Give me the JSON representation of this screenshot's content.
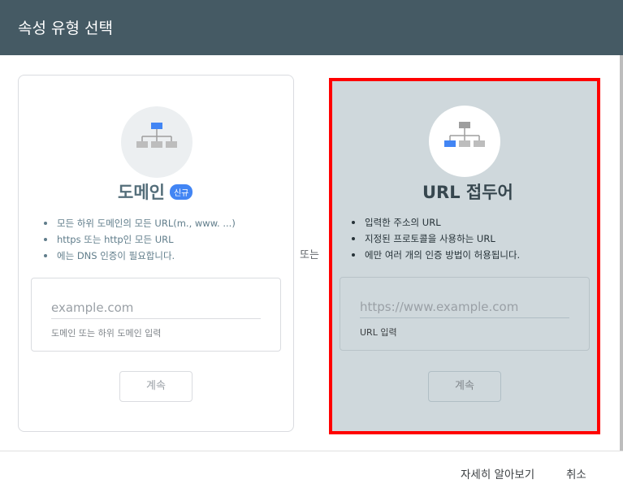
{
  "header": {
    "title": "속성 유형 선택"
  },
  "domain_card": {
    "title": "도메인",
    "badge": "신규",
    "features": [
      "모든 하위 도메인의 모든 URL(m., www. ...)",
      "https 또는 http인 모든 URL",
      "에는 DNS 인증이 필요합니다."
    ],
    "input": {
      "placeholder": "example.com",
      "value": "",
      "hint": "도메인 또는 하위 도메인 입력"
    },
    "continue_label": "계속",
    "icon": "sitemap-domain-icon"
  },
  "or_label": "또는",
  "url_card": {
    "title": "URL 접두어",
    "features": [
      "입력한 주소의 URL",
      "지정된 프로토콜을 사용하는 URL",
      "에만 여러 개의 인증 방법이 허용됩니다."
    ],
    "input": {
      "placeholder": "https://www.example.com",
      "value": "",
      "hint": "URL 입력"
    },
    "continue_label": "계속",
    "icon": "sitemap-url-prefix-icon"
  },
  "footer": {
    "learn_more": "자세히 알아보기",
    "cancel": "취소"
  },
  "colors": {
    "header_bg": "#455a64",
    "accent": "#4285f4",
    "highlight_border": "#ff0000",
    "selected_card_bg": "#cfd8dc"
  }
}
